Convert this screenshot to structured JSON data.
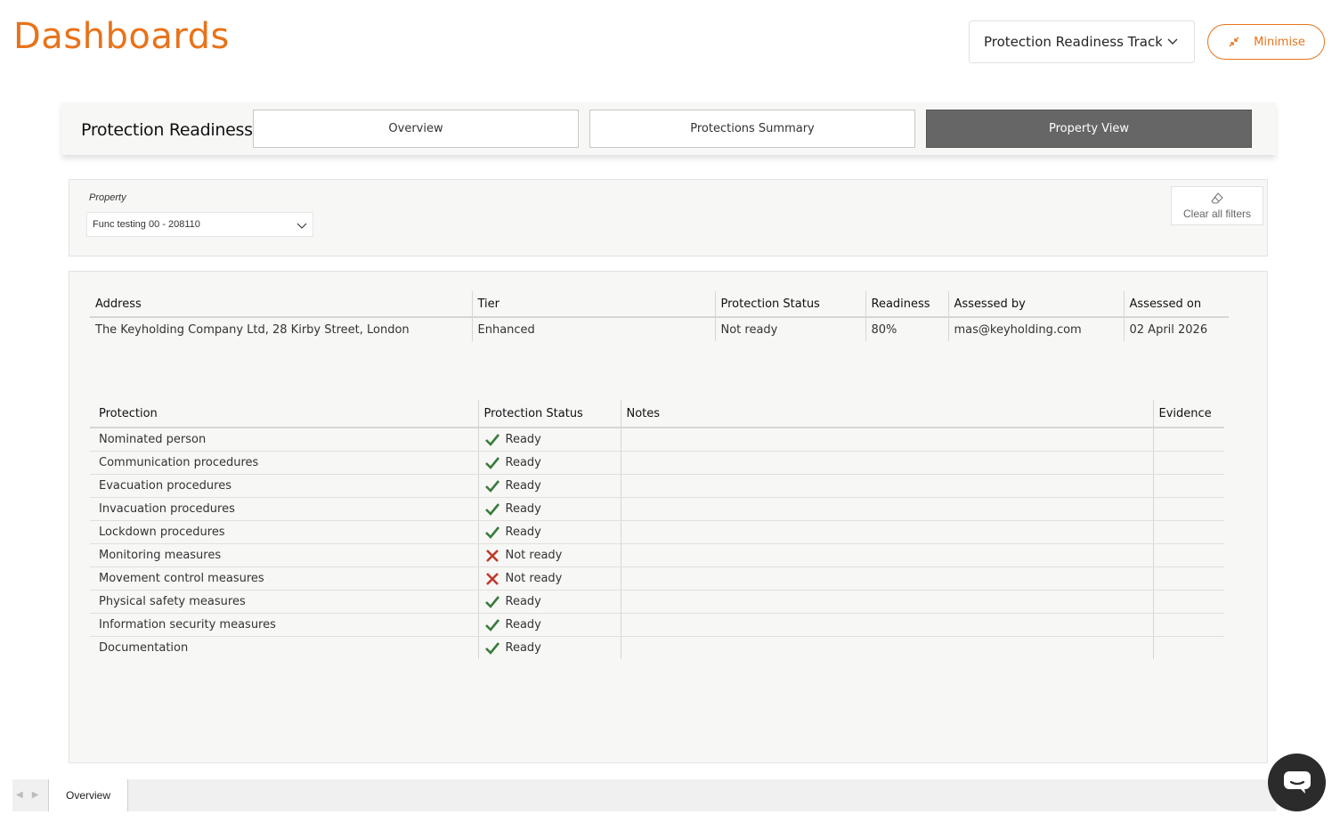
{
  "header": {
    "title": "Dashboards",
    "report_select": "Protection Readiness Track",
    "minimise_label": "Minimise"
  },
  "nav": {
    "title": "Protection Readiness",
    "tabs": [
      {
        "label": "Overview",
        "active": false
      },
      {
        "label": "Protections Summary",
        "active": false
      },
      {
        "label": "Property View",
        "active": true
      }
    ]
  },
  "filters": {
    "property_label": "Property",
    "property_value": "Func testing 00 - 208110",
    "clear_label": "Clear all filters"
  },
  "summary_table": {
    "headers": [
      "Address",
      "Tier",
      "Protection Status",
      "Readiness",
      "Assessed by",
      "Assessed on"
    ],
    "row": [
      "The Keyholding Company Ltd, 28 Kirby Street, London",
      "Enhanced",
      "Not ready",
      "80%",
      "mas@keyholding.com",
      "02 April 2026"
    ]
  },
  "protection_table": {
    "headers": [
      "Protection",
      "Protection Status",
      "Notes",
      "Evidence"
    ],
    "rows": [
      {
        "protection": "Nominated person",
        "status": "Ready",
        "ready": true
      },
      {
        "protection": "Communication procedures",
        "status": "Ready",
        "ready": true
      },
      {
        "protection": "Evacuation procedures",
        "status": "Ready",
        "ready": true
      },
      {
        "protection": "Invacuation procedures",
        "status": "Ready",
        "ready": true
      },
      {
        "protection": "Lockdown procedures",
        "status": "Ready",
        "ready": true
      },
      {
        "protection": "Monitoring measures",
        "status": "Not ready",
        "ready": false
      },
      {
        "protection": "Movement control measures",
        "status": "Not ready",
        "ready": false
      },
      {
        "protection": "Physical safety measures",
        "status": "Ready",
        "ready": true
      },
      {
        "protection": "Information security measures",
        "status": "Ready",
        "ready": true
      },
      {
        "protection": "Documentation",
        "status": "Ready",
        "ready": true
      }
    ]
  },
  "page_tabs": {
    "active": "Overview"
  },
  "colors": {
    "accent": "#e8731a",
    "ready": "#3a7a3a",
    "not_ready": "#c0392b",
    "active_tab": "#666666"
  }
}
